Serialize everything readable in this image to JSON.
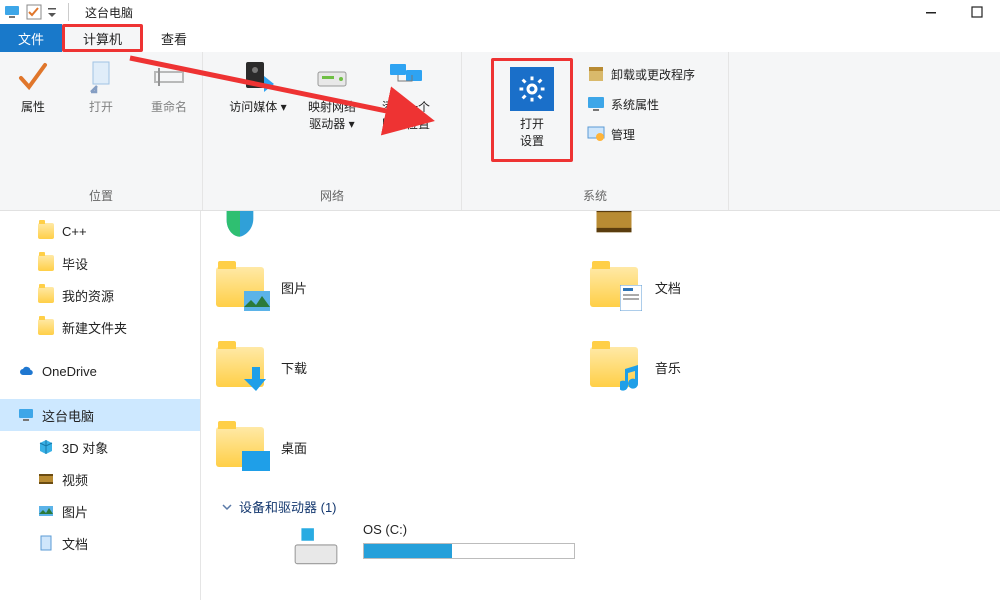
{
  "titlebar": {
    "title": "这台电脑"
  },
  "tabs": {
    "file": "文件",
    "computer": "计算机",
    "view": "查看"
  },
  "ribbon": {
    "location": {
      "label": "位置",
      "properties": "属性",
      "open": "打开",
      "rename": "重命名"
    },
    "network": {
      "label": "网络",
      "access_media": "访问媒体",
      "map_drive_l1": "映射网络",
      "map_drive_l2": "驱动器",
      "add_loc_l1": "添加一个",
      "add_loc_l2": "网络位置"
    },
    "system": {
      "label": "系统",
      "open_settings_l1": "打开",
      "open_settings_l2": "设置",
      "uninstall": "卸载或更改程序",
      "sys_props": "系统属性",
      "manage": "管理"
    }
  },
  "nav": {
    "items": [
      {
        "label": "C++"
      },
      {
        "label": "毕设"
      },
      {
        "label": "我的资源"
      },
      {
        "label": "新建文件夹"
      }
    ],
    "onedrive": "OneDrive",
    "thispc": "这台电脑",
    "thispc_children": [
      {
        "label": "3D 对象"
      },
      {
        "label": "视频"
      },
      {
        "label": "图片"
      },
      {
        "label": "文档"
      }
    ]
  },
  "main": {
    "folders": [
      {
        "label": "图片"
      },
      {
        "label": "文档"
      },
      {
        "label": "下载"
      },
      {
        "label": "音乐"
      },
      {
        "label": "桌面"
      }
    ],
    "section": "设备和驱动器 (1)",
    "drive": {
      "label": "OS (C:)",
      "fill_pct": 42
    }
  }
}
